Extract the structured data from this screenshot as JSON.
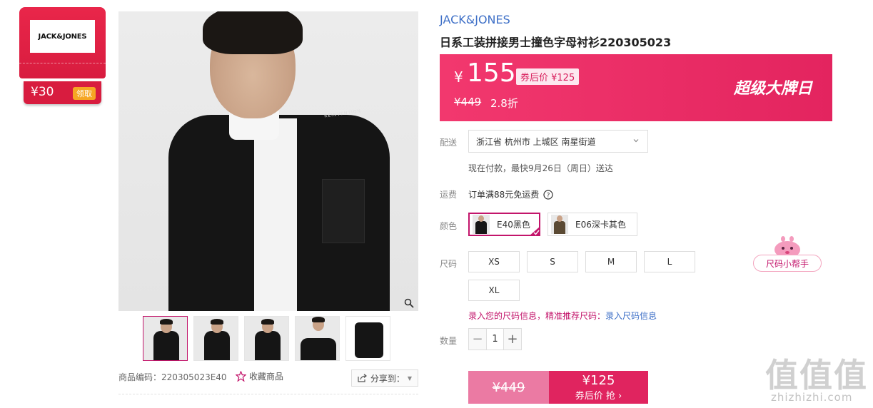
{
  "coupon": {
    "brand_logo": "JACK&JONES",
    "amount": "¥30",
    "claim_label": "领取"
  },
  "product": {
    "brand": "JACK&JONES",
    "title": "日系工装拼接男士撞色字母衬衫220305023",
    "code_text": "商品编码：220305023E40",
    "favorite_label": "收藏商品",
    "share_label": "分享到：",
    "image_print_text": "REINVENTION"
  },
  "price": {
    "currency": "¥",
    "current": "155",
    "after_coupon": "券后价 ¥125",
    "original": "¥449",
    "discount": "2.8折",
    "promo_label": "超级大牌日",
    "accent_color": "#e3245f"
  },
  "delivery": {
    "label": "配送",
    "address": "浙江省 杭州市 上城区 南星街道",
    "note": "现在付款，最快9月26日（周日）送达"
  },
  "shipping": {
    "label": "运费",
    "text": "订单满88元免运费"
  },
  "colors": {
    "label": "颜色",
    "options": [
      {
        "label": "E40黑色",
        "selected": true
      },
      {
        "label": "E06深卡其色",
        "selected": false
      }
    ]
  },
  "sizes": {
    "label": "尺码",
    "options": [
      "XS",
      "S",
      "M",
      "L",
      "XL"
    ],
    "note_prefix": "录入您的尺码信息，精准推荐尺码：",
    "note_link": "录入尺码信息",
    "helper_label": "尺码小帮手"
  },
  "quantity": {
    "label": "数量",
    "value": "1",
    "minus": "−",
    "plus": "+"
  },
  "buy": {
    "original": "¥449",
    "price": "¥125",
    "action": "券后价 抢 ›"
  },
  "watermark": {
    "big": "值值值",
    "url": "zhizhizhi.com"
  }
}
